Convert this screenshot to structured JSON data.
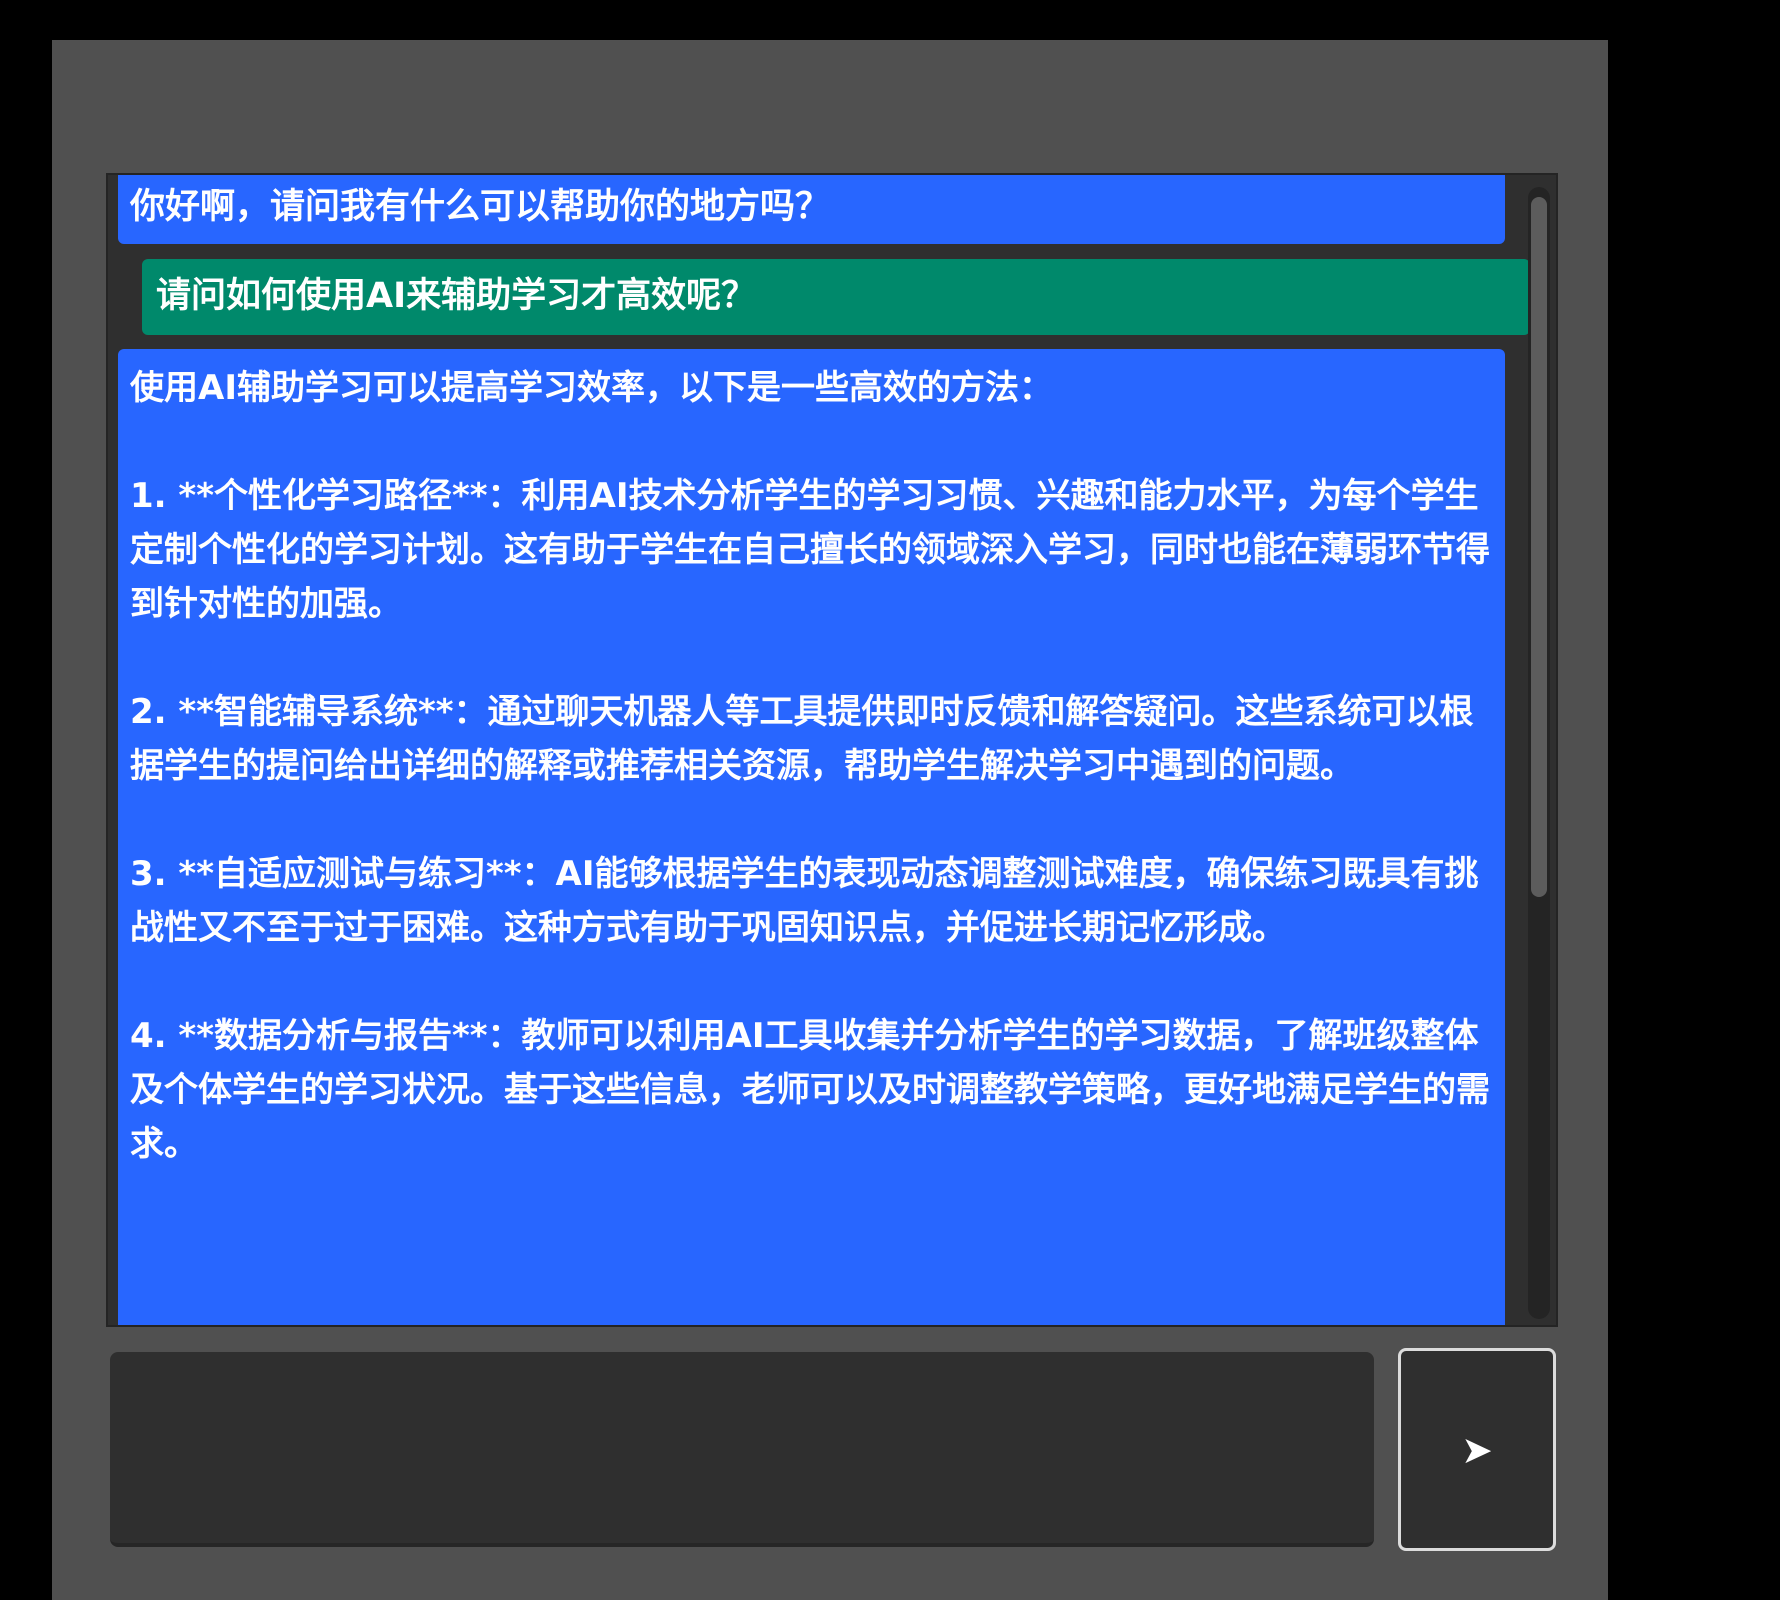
{
  "chat": {
    "messages": [
      {
        "role": "assistant",
        "text": "你好啊，请问我有什么可以帮助你的地方吗？"
      },
      {
        "role": "user",
        "text": "请问如何使用AI来辅助学习才高效呢？"
      },
      {
        "role": "assistant",
        "text": "使用AI辅助学习可以提高学习效率，以下是一些高效的方法：\n\n1. **个性化学习路径**：利用AI技术分析学生的学习习惯、兴趣和能力水平，为每个学生定制个性化的学习计划。这有助于学生在自己擅长的领域深入学习，同时也能在薄弱环节得到针对性的加强。\n\n2. **智能辅导系统**：通过聊天机器人等工具提供即时反馈和解答疑问。这些系统可以根据学生的提问给出详细的解释或推荐相关资源，帮助学生解决学习中遇到的问题。\n\n3. **自适应测试与练习**：AI能够根据学生的表现动态调整测试难度，确保练习既具有挑战性又不至于过于困难。这种方式有助于巩固知识点，并促进长期记忆形成。\n\n4. **数据分析与报告**：教师可以利用AI工具收集并分析学生的学习数据，了解班级整体及个体学生的学习状况。基于这些信息，老师可以及时调整教学策略，更好地满足学生的需求。"
      }
    ]
  },
  "composer": {
    "input_value": "",
    "send_icon": "send-arrow-icon",
    "send_glyph": "➤"
  },
  "colors": {
    "assistant_bubble": "#2866ff",
    "user_bubble": "#00896b",
    "panel_background": "#505050",
    "chat_background": "#2f2f2f"
  }
}
